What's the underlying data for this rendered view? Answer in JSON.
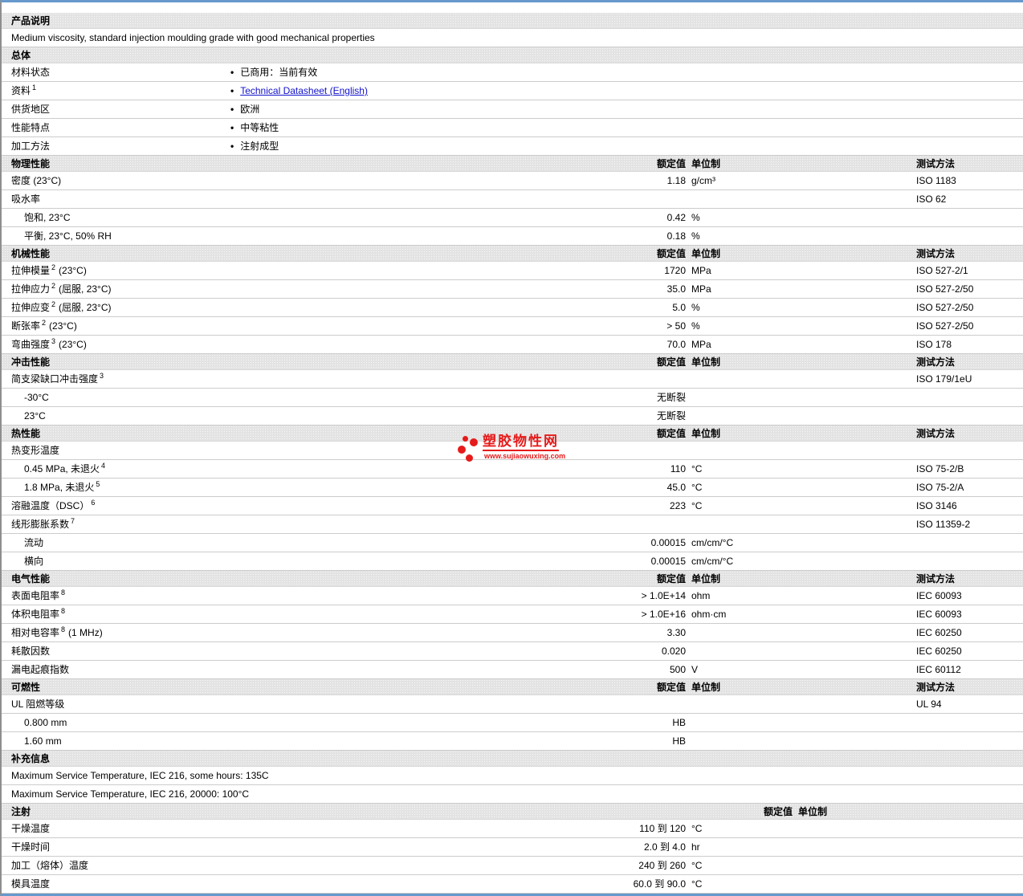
{
  "page": {
    "border_color": "#6699cc",
    "left_border_color": "#8e8e8e",
    "bar_bg_color": "#e3e3e3",
    "row_line_color": "#cccccc",
    "link_color": "#1111cc"
  },
  "watermark": {
    "title": "塑胶物性网",
    "url": "www.sujiaowuxing.com",
    "color": "#e61a1a"
  },
  "columns": {
    "value": "额定值",
    "unit": "单位制",
    "method": "测试方法"
  },
  "sections": [
    {
      "title": "产品说明",
      "show_headers": false,
      "rows": [
        {
          "full": "Medium viscosity, standard injection moulding grade with good mechanical properties"
        }
      ]
    },
    {
      "title": "总体",
      "show_headers": false,
      "rows": [
        {
          "label": "材料状态",
          "bullet": "已商用：当前有效"
        },
        {
          "label": "资料",
          "sup": "1",
          "bullet": "Technical Datasheet (English)",
          "link": true
        },
        {
          "label": "供货地区",
          "bullet": "欧洲"
        },
        {
          "label": "性能特点",
          "bullet": "中等粘性"
        },
        {
          "label": "加工方法",
          "bullet": "注射成型"
        }
      ]
    },
    {
      "title": "物理性能",
      "show_headers": true,
      "show_method": true,
      "rows": [
        {
          "label": "密度  (23°C)",
          "value": "1.18",
          "unit": "g/cm³",
          "method": "ISO 1183"
        },
        {
          "label": "吸水率",
          "method": "ISO 62"
        },
        {
          "label": "饱和, 23°C",
          "indent": true,
          "value": "0.42",
          "unit": "%"
        },
        {
          "label": "平衡, 23°C, 50% RH",
          "indent": true,
          "value": "0.18",
          "unit": "%"
        }
      ]
    },
    {
      "title": "机械性能",
      "show_headers": true,
      "show_method": true,
      "rows": [
        {
          "label": "拉伸模量",
          "sup": "2",
          "label2": "(23°C)",
          "value": "1720",
          "unit": "MPa",
          "method": "ISO 527-2/1"
        },
        {
          "label": "拉伸应力",
          "sup": "2",
          "label2": "(屈服, 23°C)",
          "value": "35.0",
          "unit": "MPa",
          "method": "ISO 527-2/50"
        },
        {
          "label": "拉伸应变",
          "sup": "2",
          "label2": "(屈服, 23°C)",
          "value": "5.0",
          "unit": "%",
          "method": "ISO 527-2/50"
        },
        {
          "label": "断张率",
          "sup": "2",
          "label2": "(23°C)",
          "value": "> 50",
          "unit": "%",
          "method": "ISO 527-2/50"
        },
        {
          "label": "弯曲强度",
          "sup": "3",
          "label2": "(23°C)",
          "value": "70.0",
          "unit": "MPa",
          "method": "ISO 178"
        }
      ]
    },
    {
      "title": "冲击性能",
      "show_headers": true,
      "show_method": true,
      "rows": [
        {
          "label": "简支梁缺口冲击强度",
          "sup": "3",
          "method": "ISO 179/1eU"
        },
        {
          "label": "-30°C",
          "indent": true,
          "value": "无断裂"
        },
        {
          "label": "23°C",
          "indent": true,
          "value": "无断裂"
        }
      ]
    },
    {
      "title": "热性能",
      "show_headers": true,
      "show_method": true,
      "rows": [
        {
          "label": "热变形温度"
        },
        {
          "label": "0.45 MPa, 未退火",
          "sup": "4",
          "indent": true,
          "value": "110",
          "unit": "°C",
          "method": "ISO 75-2/B"
        },
        {
          "label": "1.8 MPa, 未退火",
          "sup": "5",
          "indent": true,
          "value": "45.0",
          "unit": "°C",
          "method": "ISO 75-2/A"
        },
        {
          "label": "溶融温度（DSC）",
          "sup": "6",
          "value": "223",
          "unit": "°C",
          "method": "ISO 3146"
        },
        {
          "label": "线形膨胀系数",
          "sup": "7",
          "method": "ISO 11359-2"
        },
        {
          "label": "流动",
          "indent": true,
          "value": "0.00015",
          "unit": "cm/cm/°C"
        },
        {
          "label": "横向",
          "indent": true,
          "value": "0.00015",
          "unit": "cm/cm/°C"
        }
      ]
    },
    {
      "title": "电气性能",
      "show_headers": true,
      "show_method": true,
      "rows": [
        {
          "label": "表面电阻率",
          "sup": "8",
          "value": "> 1.0E+14",
          "unit": "ohm",
          "method": "IEC 60093"
        },
        {
          "label": "体积电阻率",
          "sup": "8",
          "value": "> 1.0E+16",
          "unit": "ohm·cm",
          "method": "IEC 60093"
        },
        {
          "label": "相对电容率",
          "sup": "8",
          "label2": "(1 MHz)",
          "value": "3.30",
          "method": "IEC 60250"
        },
        {
          "label": "耗散因数",
          "value": "0.020",
          "method": "IEC 60250"
        },
        {
          "label": "漏电起痕指数",
          "value": "500",
          "unit": "V",
          "method": "IEC 60112"
        }
      ]
    },
    {
      "title": "可燃性",
      "show_headers": true,
      "show_method": true,
      "rows": [
        {
          "label": "UL 阻燃等级",
          "method": "UL 94"
        },
        {
          "label": "0.800 mm",
          "indent": true,
          "value": "HB"
        },
        {
          "label": "1.60 mm",
          "indent": true,
          "value": "HB"
        }
      ]
    },
    {
      "title": "补充信息",
      "show_headers": false,
      "rows": [
        {
          "full": "Maximum Service Temperature, IEC 216, some hours: 135C"
        },
        {
          "full": "Maximum Service Temperature, IEC 216, 20000: 100°C"
        }
      ]
    },
    {
      "title": "注射",
      "show_headers": true,
      "show_method": false,
      "rows": [
        {
          "label": "干燥温度",
          "value": "110 到  120",
          "unit": "°C"
        },
        {
          "label": "干燥时间",
          "value": "2.0 到  4.0",
          "unit": "hr"
        },
        {
          "label": "加工（熔体）温度",
          "value": "240 到  260",
          "unit": "°C"
        },
        {
          "label": "模具温度",
          "value": "60.0 到  90.0",
          "unit": "°C"
        }
      ]
    }
  ]
}
